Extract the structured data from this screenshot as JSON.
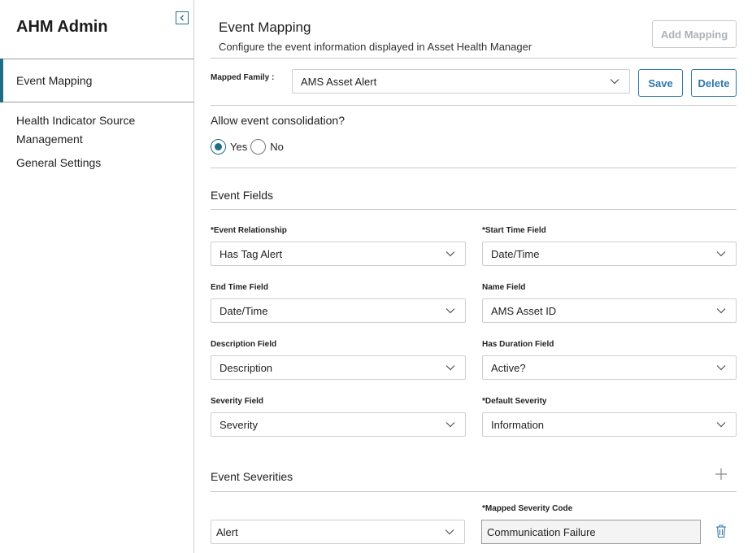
{
  "app": {
    "title": "AHM Admin"
  },
  "sidebar": {
    "items": [
      {
        "label": "Event Mapping"
      },
      {
        "label": "Health Indicator Source Management"
      },
      {
        "label": "General Settings"
      }
    ]
  },
  "header": {
    "title": "Event Mapping",
    "subtitle": "Configure the event information displayed in Asset Health Manager",
    "add_mapping_label": "Add Mapping"
  },
  "mapped_family": {
    "label": "Mapped Family :",
    "value": "AMS Asset Alert",
    "save_label": "Save",
    "delete_label": "Delete"
  },
  "consolidation": {
    "question": "Allow event consolidation?",
    "yes_label": "Yes",
    "no_label": "No",
    "selected": "Yes"
  },
  "event_fields": {
    "title": "Event Fields",
    "fields": [
      {
        "label": "*Event Relationship",
        "value": "Has Tag Alert"
      },
      {
        "label": "*Start Time Field",
        "value": "Date/Time"
      },
      {
        "label": "End Time Field",
        "value": "Date/Time"
      },
      {
        "label": "Name Field",
        "value": "AMS Asset ID"
      },
      {
        "label": "Description Field",
        "value": "Description"
      },
      {
        "label": "Has Duration Field",
        "value": "Active?"
      },
      {
        "label": "Severity Field",
        "value": "Severity"
      },
      {
        "label": "*Default Severity",
        "value": "Information"
      }
    ]
  },
  "event_severities": {
    "title": "Event Severities",
    "code_label": "*Mapped Severity Code",
    "rows": [
      {
        "severity": "Alert",
        "code": "Communication Failure"
      }
    ]
  },
  "colors": {
    "accent": "#1e6f86",
    "button_text": "#2f78a8",
    "disabled_text": "#aab2b8"
  },
  "icons": {
    "collapse": "chevron-left-icon",
    "dropdown": "chevron-down-icon",
    "add": "plus-icon",
    "delete": "trash-icon"
  }
}
